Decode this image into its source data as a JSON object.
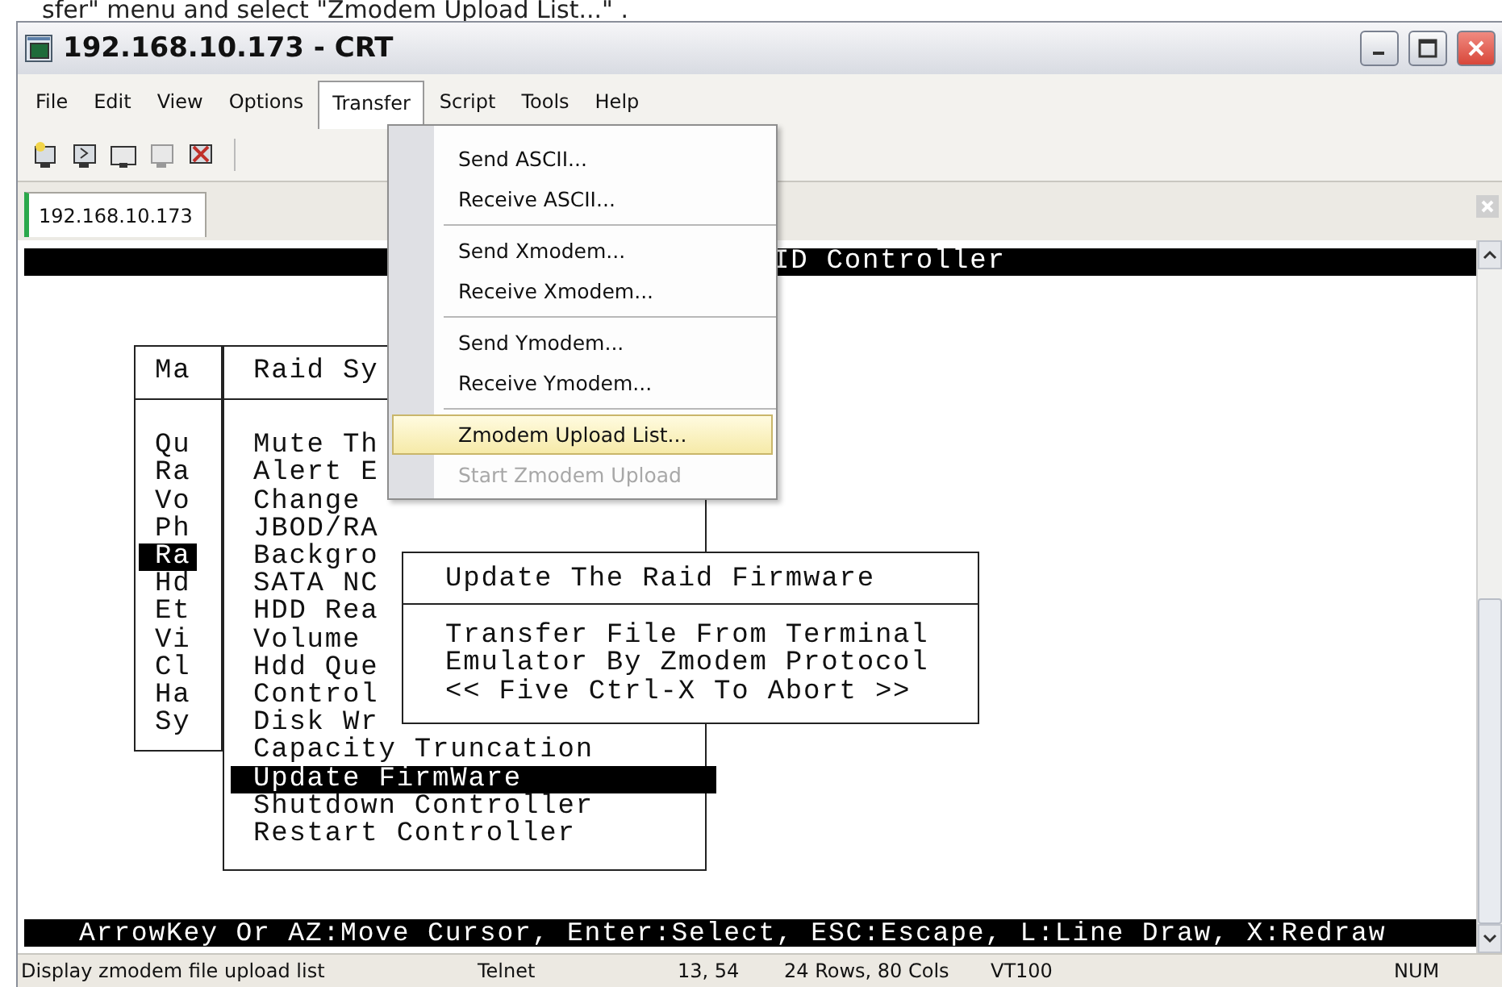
{
  "caption": "sfer\" menu and select \"Zmodem Upload List...\" .",
  "window": {
    "title": "192.168.10.173 - CRT"
  },
  "menu_bar": [
    {
      "label": "File",
      "selected": false
    },
    {
      "label": "Edit",
      "selected": false
    },
    {
      "label": "View",
      "selected": false
    },
    {
      "label": "Options",
      "selected": false
    },
    {
      "label": "Transfer",
      "selected": true
    },
    {
      "label": "Script",
      "selected": false
    },
    {
      "label": "Tools",
      "selected": false
    },
    {
      "label": "Help",
      "selected": false
    }
  ],
  "tabs": [
    {
      "label": "192.168.10.173",
      "selected": true
    }
  ],
  "transfer_menu": [
    {
      "kind": "item",
      "label": "Send ASCII...",
      "highlighted": false,
      "disabled": false
    },
    {
      "kind": "item",
      "label": "Receive ASCII...",
      "highlighted": false,
      "disabled": false
    },
    {
      "kind": "separator"
    },
    {
      "kind": "item",
      "label": "Send Xmodem...",
      "highlighted": false,
      "disabled": false
    },
    {
      "kind": "item",
      "label": "Receive Xmodem...",
      "highlighted": false,
      "disabled": false
    },
    {
      "kind": "separator"
    },
    {
      "kind": "item",
      "label": "Send Ymodem...",
      "highlighted": false,
      "disabled": false
    },
    {
      "kind": "item",
      "label": "Receive Ymodem...",
      "highlighted": false,
      "disabled": false
    },
    {
      "kind": "separator"
    },
    {
      "kind": "item",
      "label": "Zmodem Upload List...",
      "highlighted": true,
      "disabled": false
    },
    {
      "kind": "item",
      "label": "Start Zmodem Upload",
      "highlighted": false,
      "disabled": true
    }
  ],
  "terminal": {
    "header_line": "ID Controller",
    "windows": [
      {
        "kind": "menu",
        "title": "Ma",
        "items": [
          {
            "label": "Qu",
            "selected": false
          },
          {
            "label": "Ra",
            "selected": false
          },
          {
            "label": "Vo",
            "selected": false
          },
          {
            "label": "Ph",
            "selected": false
          },
          {
            "label": "Ra",
            "selected": true
          },
          {
            "label": "Hd",
            "selected": false
          },
          {
            "label": "Et",
            "selected": false
          },
          {
            "label": "Vi",
            "selected": false
          },
          {
            "label": "Cl",
            "selected": false
          },
          {
            "label": "Ha",
            "selected": false
          },
          {
            "label": "Sy",
            "selected": false
          }
        ]
      },
      {
        "kind": "menu",
        "title": "Raid Sy",
        "items": [
          {
            "label": "Mute Th",
            "selected": false
          },
          {
            "label": "Alert E",
            "selected": false
          },
          {
            "label": "Change",
            "selected": false
          },
          {
            "label": "JBOD/RA",
            "selected": false
          },
          {
            "label": "Backgro",
            "selected": false
          },
          {
            "label": "SATA NC",
            "selected": false
          },
          {
            "label": "HDD Rea",
            "selected": false
          },
          {
            "label": "Volume",
            "selected": false
          },
          {
            "label": "Hdd Que",
            "selected": false
          },
          {
            "label": "Control",
            "selected": false
          },
          {
            "label": "Disk Wr",
            "selected": false
          },
          {
            "label": "Capacity Truncation",
            "selected": false
          },
          {
            "label": "Update FirmWare",
            "selected": true
          },
          {
            "label": "Shutdown Controller",
            "selected": false
          },
          {
            "label": "Restart Controller",
            "selected": false
          }
        ]
      },
      {
        "kind": "message",
        "title": "Update The Raid Firmware",
        "lines": [
          "Transfer File From Terminal",
          "Emulator By Zmodem Protocol",
          "<< Five Ctrl-X To Abort >>"
        ]
      }
    ],
    "help_line": "ArrowKey Or AZ:Move Cursor, Enter:Select, ESC:Escape, L:Line Draw, X:Redraw"
  },
  "status_bar": [
    "Display zmodem file upload list",
    "Telnet",
    "13, 54",
    "24 Rows, 80 Cols",
    "VT100",
    "NUM"
  ]
}
